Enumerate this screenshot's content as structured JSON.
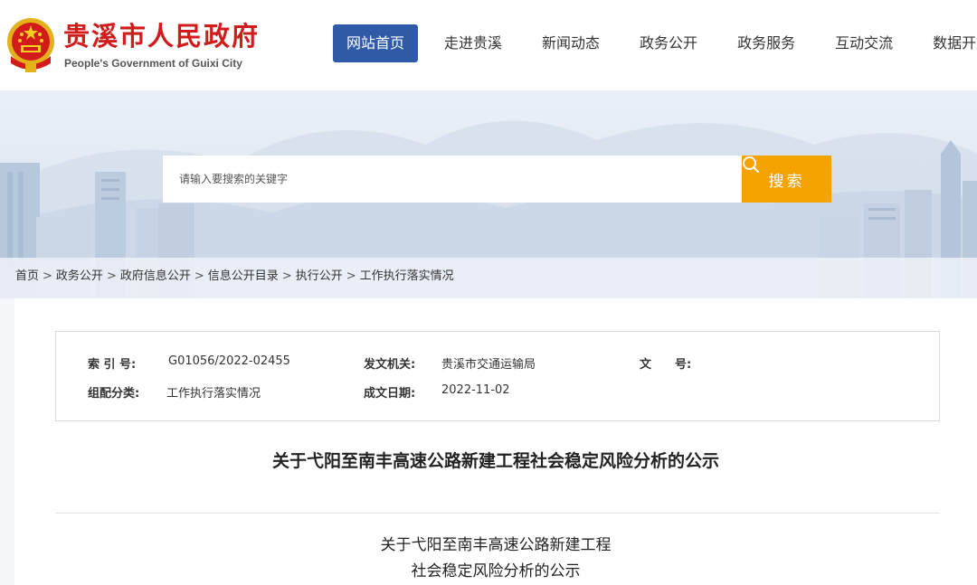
{
  "header": {
    "title": "贵溪市人民政府",
    "subtitle": "People's Government of Guixi City",
    "nav": [
      {
        "label": "网站首页",
        "active": true
      },
      {
        "label": "走进贵溪",
        "active": false
      },
      {
        "label": "新闻动态",
        "active": false
      },
      {
        "label": "政务公开",
        "active": false
      },
      {
        "label": "政务服务",
        "active": false
      },
      {
        "label": "互动交流",
        "active": false
      },
      {
        "label": "数据开放",
        "active": false
      }
    ]
  },
  "search": {
    "placeholder": "请输入要搜索的关键字",
    "button_label": "搜索",
    "button_color": "#f5a300"
  },
  "breadcrumb": [
    "首页",
    "政务公开",
    "政府信息公开",
    "信息公开目录",
    "执行公开",
    "工作执行落实情况"
  ],
  "meta": {
    "index_label": "索 引 号:",
    "index_value": "G01056/2022-02455",
    "issuer_label": "发文机关:",
    "issuer_value": "贵溪市交通运输局",
    "docno_label": "文　　号:",
    "docno_value": "",
    "category_label": "组配分类:",
    "category_value": "工作执行落实情况",
    "date_label": "成文日期:",
    "date_value": "2022-11-02"
  },
  "article": {
    "title": "关于弋阳至南丰高速公路新建工程社会稳定风险分析的公示",
    "body_line1": "关于弋阳至南丰高速公路新建工程",
    "body_line2": "社会稳定风险分析的公示"
  },
  "colors": {
    "brand_red": "#d21c1c",
    "nav_active": "#2f5aa8"
  }
}
